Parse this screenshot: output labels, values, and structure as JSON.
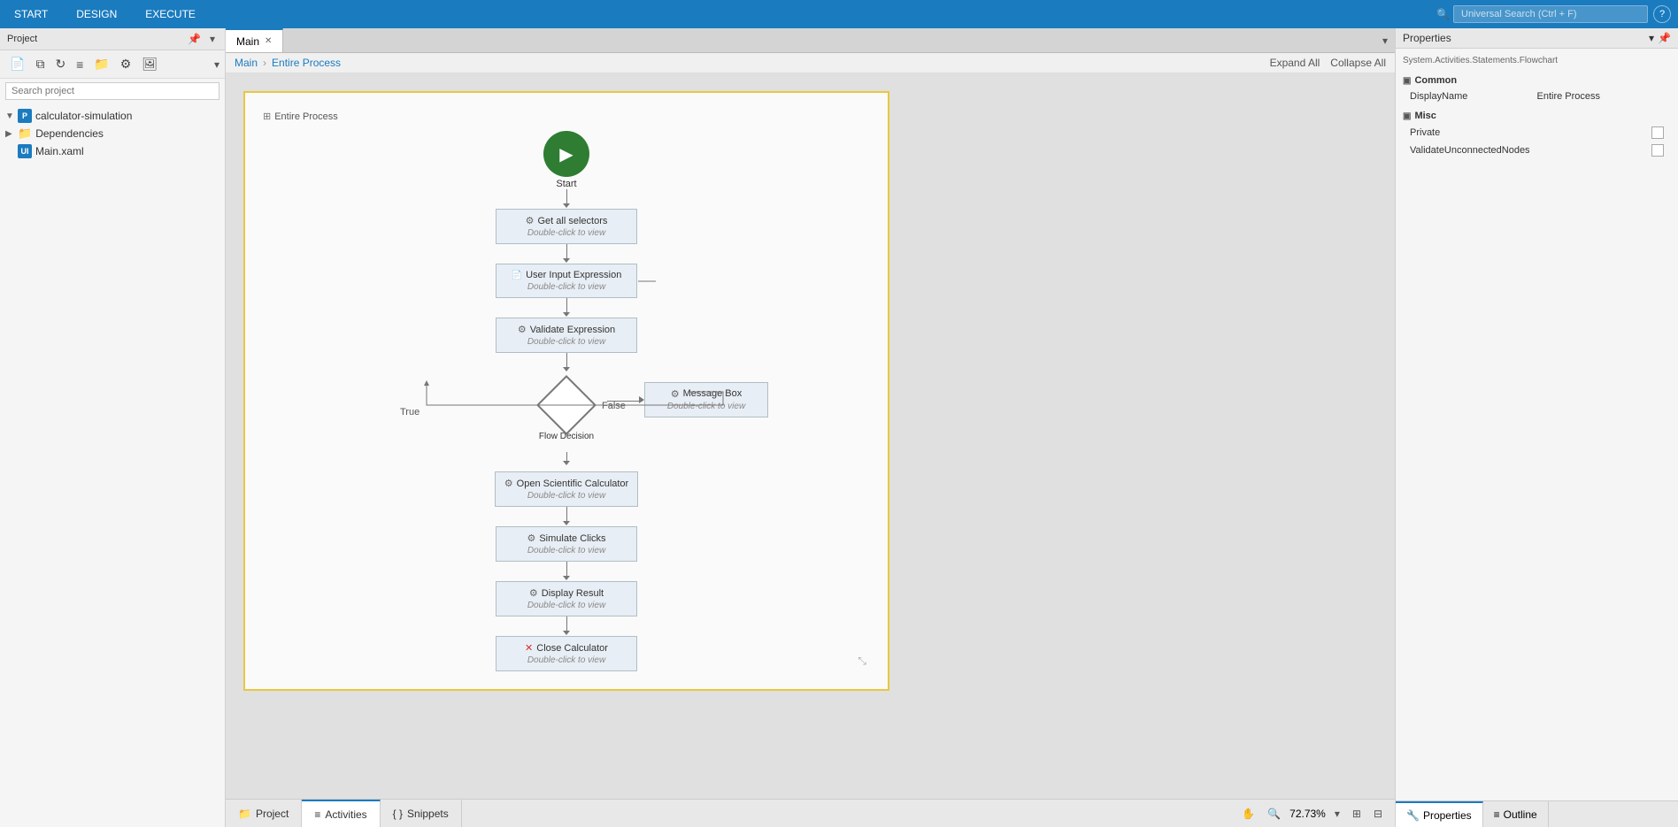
{
  "app": {
    "menu_items": [
      "START",
      "DESIGN",
      "EXECUTE"
    ],
    "search_placeholder": "Universal Search (Ctrl + F)",
    "help_label": "?"
  },
  "left_panel": {
    "title": "Project",
    "search_placeholder": "Search project",
    "project_name": "calculator-simulation",
    "dependencies_label": "Dependencies",
    "main_file": "Main.xaml"
  },
  "tabs": [
    {
      "label": "Main",
      "active": true,
      "closable": true
    }
  ],
  "breadcrumb": {
    "parent": "Main",
    "current": "Entire Process"
  },
  "canvas": {
    "expand_all": "Expand All",
    "collapse_all": "Collapse All",
    "flowchart_title": "Entire Process",
    "nodes": [
      {
        "id": "start",
        "type": "start",
        "label": "Start"
      },
      {
        "id": "get-selectors",
        "type": "activity",
        "label": "Get all selectors",
        "sub": "Double-click to view",
        "icon": "gear"
      },
      {
        "id": "user-input",
        "type": "activity",
        "label": "User Input Expression",
        "sub": "Double-click to view",
        "icon": "doc"
      },
      {
        "id": "validate",
        "type": "activity",
        "label": "Validate Expression",
        "sub": "Double-click to view",
        "icon": "gear"
      },
      {
        "id": "decision",
        "type": "decision",
        "label": "Flow Decision",
        "true_label": "True",
        "false_label": "False"
      },
      {
        "id": "message-box",
        "type": "activity",
        "label": "Message Box",
        "sub": "Double-click to view",
        "icon": "gear"
      },
      {
        "id": "open-calc",
        "type": "activity",
        "label": "Open Scientific Calculator",
        "sub": "Double-click to view",
        "icon": "gear"
      },
      {
        "id": "simulate",
        "type": "activity",
        "label": "Simulate Clicks",
        "sub": "Double-click to view",
        "icon": "gear"
      },
      {
        "id": "display",
        "type": "activity",
        "label": "Display Result",
        "sub": "Double-click to view",
        "icon": "gear"
      },
      {
        "id": "close-calc",
        "type": "activity",
        "label": "Close Calculator",
        "sub": "Double-click to view",
        "icon": "error"
      }
    ]
  },
  "bottom_tabs": [
    {
      "label": "Project",
      "icon": "folder",
      "active": false
    },
    {
      "label": "Activities",
      "icon": "list",
      "active": true
    },
    {
      "label": "Snippets",
      "icon": "code",
      "active": false
    }
  ],
  "status_bar": {
    "zoom": "72.73%",
    "hand_tool": "✋",
    "search_icon": "🔍",
    "fit_all": "⊞",
    "fit_page": "⊟"
  },
  "properties": {
    "panel_title": "Properties",
    "class_name": "System.Activities.Statements.Flowchart",
    "sections": [
      {
        "label": "Common",
        "collapsed": false,
        "rows": [
          {
            "label": "DisplayName",
            "value": "Entire Process",
            "type": "text"
          }
        ]
      },
      {
        "label": "Misc",
        "collapsed": false,
        "rows": [
          {
            "label": "Private",
            "value": "",
            "type": "checkbox"
          },
          {
            "label": "ValidateUnconnectedNodes",
            "value": "",
            "type": "checkbox"
          }
        ]
      }
    ]
  },
  "right_bottom_tabs": [
    {
      "label": "Properties",
      "icon": "wrench",
      "active": true
    },
    {
      "label": "Outline",
      "icon": "list",
      "active": false
    }
  ]
}
